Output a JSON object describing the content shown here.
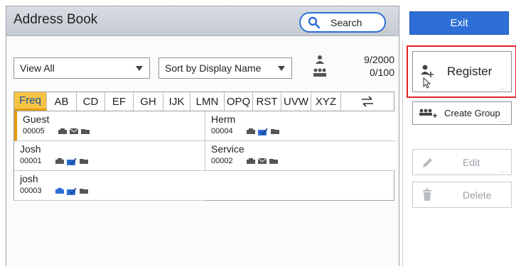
{
  "header": {
    "title": "Address Book",
    "search_label": "Search"
  },
  "filters": {
    "view": "View All",
    "sort": "Sort by Display Name"
  },
  "counts": {
    "users": "9/2000",
    "groups": "0/100"
  },
  "tabs": [
    {
      "label": "Freq",
      "active": true
    },
    {
      "label": "AB"
    },
    {
      "label": "CD"
    },
    {
      "label": "EF"
    },
    {
      "label": "GH"
    },
    {
      "label": "IJK"
    },
    {
      "label": "LMN"
    },
    {
      "label": "OPQ"
    },
    {
      "label": "RST"
    },
    {
      "label": "UVW"
    },
    {
      "label": "XYZ"
    },
    {
      "label": "",
      "icon": "switch-icon"
    }
  ],
  "entries": [
    {
      "name": "Guest",
      "number": "00005",
      "selected": true
    },
    {
      "name": "Herm",
      "number": "00004"
    },
    {
      "name": "Josh",
      "number": "00001"
    },
    {
      "name": "Service",
      "number": "00002"
    },
    {
      "name": "josh",
      "number": "00003"
    }
  ],
  "actions": {
    "exit": "Exit",
    "register": "Register",
    "create_group": "Create Group",
    "edit": "Edit",
    "delete": "Delete"
  },
  "colors": {
    "accent_blue": "#2d6fd6",
    "active_tab": "#f6c445",
    "highlight_red": "#e02424"
  }
}
